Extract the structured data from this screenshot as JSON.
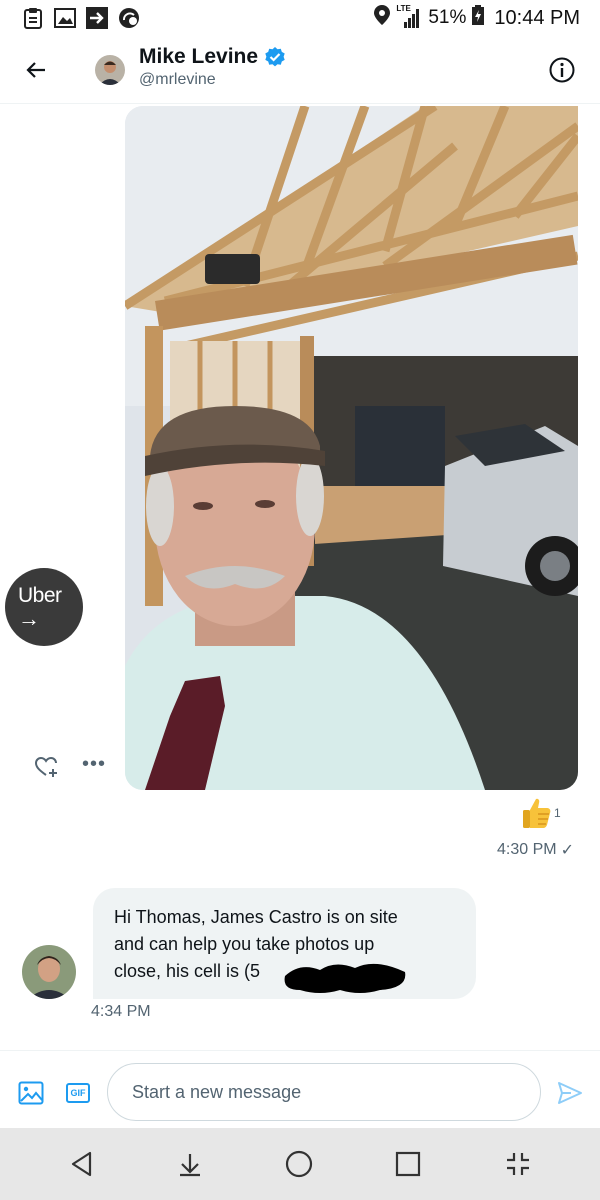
{
  "status_bar": {
    "battery": "51%",
    "time": "10:44 PM",
    "network": "LTE",
    "icons": [
      "clipboard-icon",
      "image-icon",
      "arrow-box-icon",
      "notification-icon",
      "location-icon",
      "signal-icon",
      "battery-icon"
    ]
  },
  "header": {
    "name": "Mike Levine",
    "handle": "@mrlevine",
    "verified": true
  },
  "uber": {
    "label": "Uber",
    "arrow": "→"
  },
  "actions": {
    "more": "•••"
  },
  "reaction": {
    "emoji": "thumbs-up",
    "count": "1"
  },
  "sent_message": {
    "time": "4:30 PM",
    "checkmark": "✓"
  },
  "received_message": {
    "lines": [
      "Hi Thomas, James Castro is on site",
      "and can help you take photos up",
      "close, his cell is (5"
    ],
    "time": "4:34 PM"
  },
  "composer": {
    "placeholder": "Start a new message",
    "gif_label": "GIF"
  },
  "colors": {
    "accent": "#1d9bf0",
    "bubble": "#eff3f4",
    "muted": "#536471",
    "uber_bg": "#3a3a3a"
  }
}
